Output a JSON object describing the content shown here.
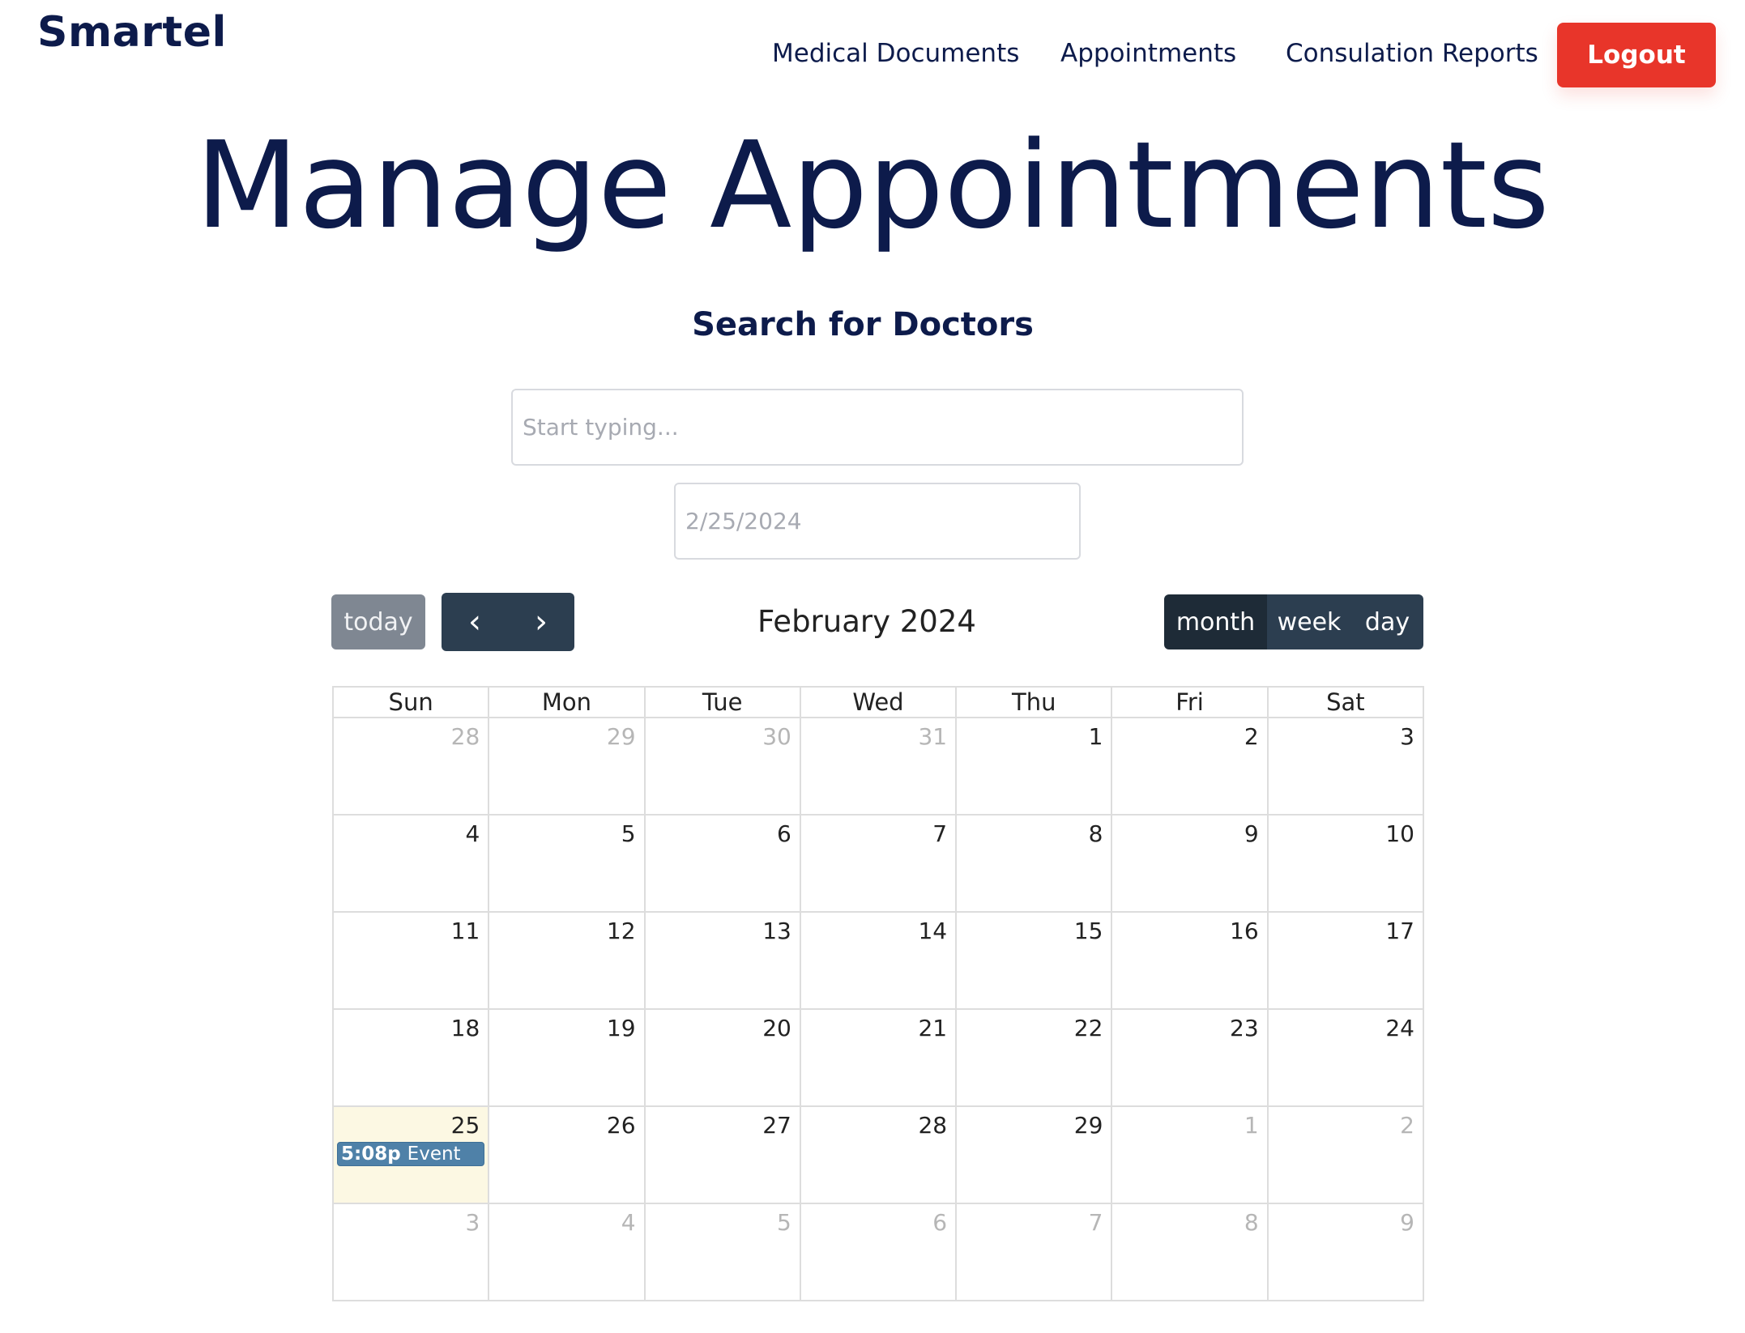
{
  "header": {
    "brand": "Smartel",
    "nav": [
      "Medical Documents",
      "Appointments",
      "Consulation Reports"
    ],
    "logout_label": "Logout"
  },
  "main": {
    "title": "Manage Appointments",
    "search_title": "Search for Doctors",
    "search_placeholder": "Start typing...",
    "date_placeholder": "2/25/2024"
  },
  "calendar": {
    "today_label": "today",
    "prev_icon": "chevron-left-icon",
    "next_icon": "chevron-right-icon",
    "title": "February 2024",
    "views": [
      "month",
      "week",
      "day"
    ],
    "active_view": "month",
    "weekdays": [
      "Sun",
      "Mon",
      "Tue",
      "Wed",
      "Thu",
      "Fri",
      "Sat"
    ],
    "weeks": [
      [
        {
          "d": "28",
          "o": true
        },
        {
          "d": "29",
          "o": true
        },
        {
          "d": "30",
          "o": true
        },
        {
          "d": "31",
          "o": true
        },
        {
          "d": "1"
        },
        {
          "d": "2"
        },
        {
          "d": "3"
        }
      ],
      [
        {
          "d": "4"
        },
        {
          "d": "5"
        },
        {
          "d": "6"
        },
        {
          "d": "7"
        },
        {
          "d": "8"
        },
        {
          "d": "9"
        },
        {
          "d": "10"
        }
      ],
      [
        {
          "d": "11"
        },
        {
          "d": "12"
        },
        {
          "d": "13"
        },
        {
          "d": "14"
        },
        {
          "d": "15"
        },
        {
          "d": "16"
        },
        {
          "d": "17"
        }
      ],
      [
        {
          "d": "18"
        },
        {
          "d": "19"
        },
        {
          "d": "20"
        },
        {
          "d": "21"
        },
        {
          "d": "22"
        },
        {
          "d": "23"
        },
        {
          "d": "24"
        }
      ],
      [
        {
          "d": "25",
          "today": true,
          "event": {
            "time": "5:08p",
            "title": "Event"
          }
        },
        {
          "d": "26"
        },
        {
          "d": "27"
        },
        {
          "d": "28"
        },
        {
          "d": "29"
        },
        {
          "d": "1",
          "o": true
        },
        {
          "d": "2",
          "o": true
        }
      ],
      [
        {
          "d": "3",
          "o": true
        },
        {
          "d": "4",
          "o": true
        },
        {
          "d": "5",
          "o": true
        },
        {
          "d": "6",
          "o": true
        },
        {
          "d": "7",
          "o": true
        },
        {
          "d": "8",
          "o": true
        },
        {
          "d": "9",
          "o": true
        }
      ]
    ],
    "colors": {
      "today_bg": "#fcf8e3",
      "event_bg": "#4f81a8",
      "logout_bg": "#e8352a",
      "toolbar_dark": "#2c3e50"
    }
  }
}
